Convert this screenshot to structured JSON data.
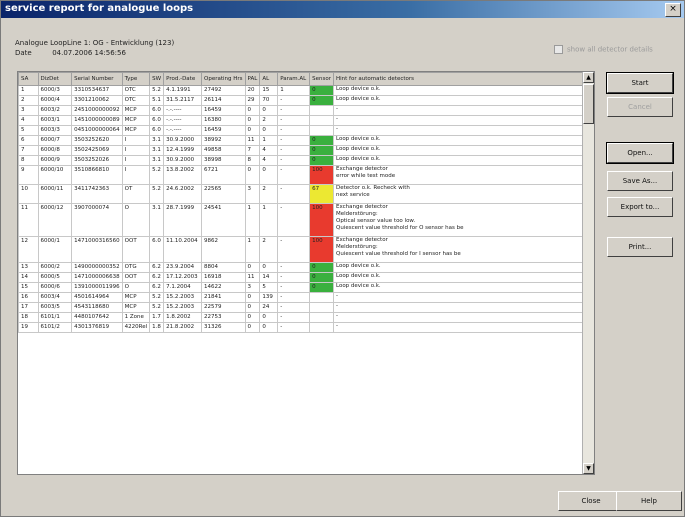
{
  "window": {
    "title": "service report for analogue loops",
    "close_glyph": "×"
  },
  "info": {
    "line1": "Analogue LoopLine 1: OG - Entwicklung (123)",
    "date_label": "Date",
    "date_value": "04.07.2006 14:56:56"
  },
  "checkbox": {
    "label": "show all detector details"
  },
  "table": {
    "headers": [
      "SA",
      "DizDet",
      "Serial Number",
      "Type",
      "SW",
      "Prod.-Date",
      "Operating Hrs",
      "PAL",
      "AL",
      "Param.AL",
      "Sensor",
      "Hint for automatic detectors"
    ],
    "rows": [
      {
        "sa": "1",
        "det": "6000/3",
        "serial": "3310534637",
        "type": "OTC",
        "sw": "5.2",
        "date": "4.1.1991",
        "hrs": "27492",
        "pal": "20",
        "al": "15",
        "param": "1",
        "sensor": "0",
        "color": "#3ab03e",
        "hint": [
          "Loop device o.k."
        ]
      },
      {
        "sa": "2",
        "det": "6000/4",
        "serial": "3301210062",
        "type": "OTC",
        "sw": "5.1",
        "date": "31.5.2117",
        "hrs": "26114",
        "pal": "29",
        "al": "70",
        "param": "-",
        "sensor": "0",
        "color": "#3ab03e",
        "hint": [
          "Loop device o.k."
        ]
      },
      {
        "sa": "3",
        "det": "6003/2",
        "serial": "2451000000092",
        "type": "MCP",
        "sw": "6.0",
        "date": "-.-.----",
        "hrs": "16459",
        "pal": "0",
        "al": "0",
        "param": "-",
        "sensor": "",
        "color": "",
        "hint": [
          "-"
        ]
      },
      {
        "sa": "4",
        "det": "6003/1",
        "serial": "1451000000089",
        "type": "MCP",
        "sw": "6.0",
        "date": "-.-.----",
        "hrs": "16380",
        "pal": "0",
        "al": "2",
        "param": "-",
        "sensor": "",
        "color": "",
        "hint": [
          "-"
        ]
      },
      {
        "sa": "5",
        "det": "6003/3",
        "serial": "0451000000064",
        "type": "MCP",
        "sw": "6.0",
        "date": "-.-.----",
        "hrs": "16459",
        "pal": "0",
        "al": "0",
        "param": "-",
        "sensor": "",
        "color": "",
        "hint": [
          "-"
        ]
      },
      {
        "sa": "6",
        "det": "6000/7",
        "serial": "3503252620",
        "type": "I",
        "sw": "3.1",
        "date": "30.9.2000",
        "hrs": "38992",
        "pal": "11",
        "al": "1",
        "param": "-",
        "sensor": "0",
        "color": "#3ab03e",
        "hint": [
          "Loop device o.k."
        ]
      },
      {
        "sa": "7",
        "det": "6000/8",
        "serial": "3502425069",
        "type": "I",
        "sw": "3.1",
        "date": "12.4.1999",
        "hrs": "49858",
        "pal": "7",
        "al": "4",
        "param": "-",
        "sensor": "0",
        "color": "#3ab03e",
        "hint": [
          "Loop device o.k."
        ]
      },
      {
        "sa": "8",
        "det": "6000/9",
        "serial": "3503252026",
        "type": "I",
        "sw": "3.1",
        "date": "30.9.2000",
        "hrs": "38998",
        "pal": "8",
        "al": "4",
        "param": "-",
        "sensor": "0",
        "color": "#3ab03e",
        "hint": [
          "Loop device o.k."
        ]
      },
      {
        "sa": "9",
        "det": "6000/10",
        "serial": "3510866810",
        "type": "I",
        "sw": "5.2",
        "date": "13.8.2002",
        "hrs": "6721",
        "pal": "0",
        "al": "0",
        "param": "-",
        "sensor": "100",
        "color": "#e83a2e",
        "hint": [
          "Exchange detector",
          "error while test mode"
        ]
      },
      {
        "sa": "10",
        "det": "6000/11",
        "serial": "3411742363",
        "type": "OT",
        "sw": "5.2",
        "date": "24.6.2002",
        "hrs": "22565",
        "pal": "3",
        "al": "2",
        "param": "-",
        "sensor": "67",
        "color": "#ece832",
        "hint": [
          "Detector o.k. Recheck with",
          "next service"
        ]
      },
      {
        "sa": "11",
        "det": "6000/12",
        "serial": "3907000074",
        "type": "O",
        "sw": "3.1",
        "date": "28.7.1999",
        "hrs": "24541",
        "pal": "1",
        "al": "1",
        "param": "-",
        "sensor": "100",
        "color": "#e83a2e",
        "hint": [
          "Exchange detector",
          "Melderstörung:",
          "Optical sensor value too low.",
          "Quiescent value threshold for O sensor has be"
        ]
      },
      {
        "sa": "12",
        "det": "6000/1",
        "serial": "1471000316560",
        "type": "OOT",
        "sw": "6.0",
        "date": "11.10.2004",
        "hrs": "9862",
        "pal": "1",
        "al": "2",
        "param": "-",
        "sensor": "100",
        "color": "#e83a2e",
        "hint": [
          "Exchange detector",
          "Melderstörung:",
          "Quiescent value threshold for I sensor has be"
        ]
      },
      {
        "sa": "13",
        "det": "6000/2",
        "serial": "1490000000352",
        "type": "OTG",
        "sw": "6.2",
        "date": "23.9.2004",
        "hrs": "8804",
        "pal": "0",
        "al": "0",
        "param": "-",
        "sensor": "0",
        "color": "#3ab03e",
        "hint": [
          "Loop device o.k."
        ]
      },
      {
        "sa": "14",
        "det": "6000/5",
        "serial": "1471000006638",
        "type": "OOT",
        "sw": "6.2",
        "date": "17.12.2003",
        "hrs": "16918",
        "pal": "11",
        "al": "14",
        "param": "-",
        "sensor": "0",
        "color": "#3ab03e",
        "hint": [
          "Loop device o.k."
        ]
      },
      {
        "sa": "15",
        "det": "6000/6",
        "serial": "1391000011996",
        "type": "O",
        "sw": "6.2",
        "date": "7.1.2004",
        "hrs": "14622",
        "pal": "3",
        "al": "5",
        "param": "-",
        "sensor": "0",
        "color": "#3ab03e",
        "hint": [
          "Loop device o.k."
        ]
      },
      {
        "sa": "16",
        "det": "6003/4",
        "serial": "4501614964",
        "type": "MCP",
        "sw": "5.2",
        "date": "15.2.2003",
        "hrs": "21841",
        "pal": "0",
        "al": "139",
        "param": "-",
        "sensor": "",
        "color": "",
        "hint": [
          "-"
        ]
      },
      {
        "sa": "17",
        "det": "6003/5",
        "serial": "4543118680",
        "type": "MCP",
        "sw": "5.2",
        "date": "15.2.2003",
        "hrs": "22579",
        "pal": "0",
        "al": "24",
        "param": "-",
        "sensor": "",
        "color": "",
        "hint": [
          "-"
        ]
      },
      {
        "sa": "18",
        "det": "6101/1",
        "serial": "4480107642",
        "type": "1 Zone",
        "sw": "1.7",
        "date": "1.8.2002",
        "hrs": "22753",
        "pal": "0",
        "al": "0",
        "param": "-",
        "sensor": "",
        "color": "",
        "hint": [
          "-"
        ]
      },
      {
        "sa": "19",
        "det": "6101/2",
        "serial": "4301376819",
        "type": "4220Rel",
        "sw": "1.8",
        "date": "21.8.2002",
        "hrs": "31326",
        "pal": "0",
        "al": "0",
        "param": "-",
        "sensor": "",
        "color": "",
        "hint": [
          "-"
        ]
      }
    ]
  },
  "buttons": {
    "start": "Start",
    "cancel": "Cancel",
    "open": "Open...",
    "save_as": "Save As...",
    "export": "Export to...",
    "print": "Print...",
    "close": "Close",
    "help": "Help"
  }
}
